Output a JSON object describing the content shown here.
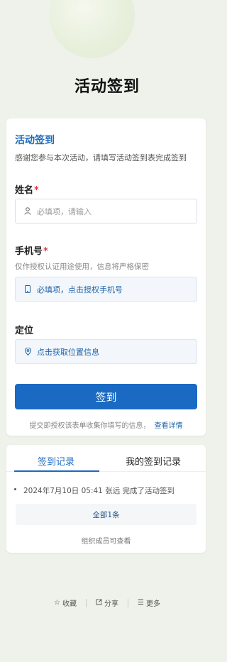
{
  "page": {
    "title": "活动签到"
  },
  "form": {
    "title": "活动签到",
    "description": "感谢您参与本次活动，请填写活动签到表完成签到",
    "name": {
      "label": "姓名",
      "required": "*",
      "placeholder": "必填项，请输入",
      "icon": "user-icon"
    },
    "phone": {
      "label": "手机号",
      "required": "*",
      "hint": "仅作授权认证用途使用，信息将严格保密",
      "action": "必填项，点击授权手机号",
      "icon": "phone-icon"
    },
    "location": {
      "label": "定位",
      "action": "点击获取位置信息",
      "icon": "location-pin-icon"
    },
    "submit_label": "签到",
    "notice": "提交即授权该表单收集你填写的信息，",
    "notice_link": "查看详情"
  },
  "records": {
    "tabs": [
      {
        "label": "签到记录",
        "active": true
      },
      {
        "label": "我的签到记录",
        "active": false
      }
    ],
    "items": [
      {
        "text": "2024年7月10日 05:41 张远 完成了活动签到"
      }
    ],
    "all_button": "全部1条",
    "visibility_note": "组织成员可查看"
  },
  "footer": {
    "items": [
      {
        "label": "收藏",
        "icon": "star-icon"
      },
      {
        "label": "分享",
        "icon": "share-icon"
      },
      {
        "label": "更多",
        "icon": "menu-icon"
      }
    ]
  },
  "colors": {
    "accent": "#1a69c2",
    "required": "#e0383e",
    "background": "#eef2ea"
  }
}
